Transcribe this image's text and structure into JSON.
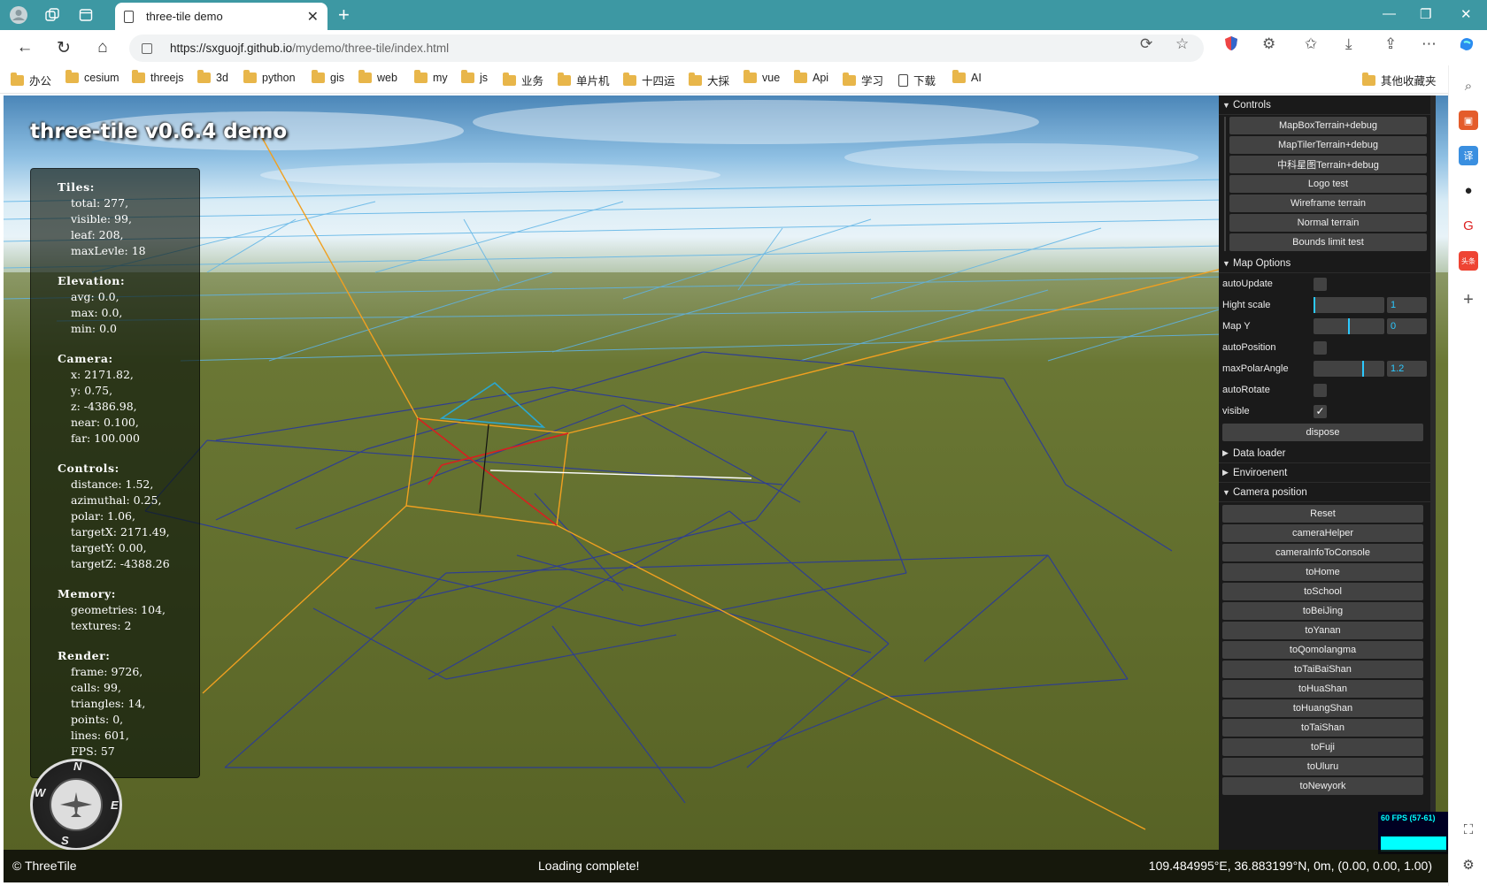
{
  "browser": {
    "tab_title": "three-tile demo",
    "url_host": "https://sxguojf.github.io",
    "url_path": "/mydemo/three-tile/index.html"
  },
  "bookmarks": [
    "办公",
    "cesium",
    "threejs",
    "3d",
    "python",
    "gis",
    "web",
    "my",
    "js",
    "业务",
    "单片机",
    "十四运",
    "大採",
    "vue",
    "Api",
    "学习",
    "下载",
    "AI"
  ],
  "bookmark_other": "其他收藏夹",
  "demo": {
    "title": "three-tile v0.6.4 demo"
  },
  "info": {
    "tiles_head": "Tiles:",
    "tiles": [
      "total: 277,",
      "visible: 99,",
      "leaf: 208,",
      "maxLevle: 18"
    ],
    "elevation_head": "Elevation:",
    "elevation": [
      "avg: 0.0,",
      "max: 0.0,",
      "min: 0.0"
    ],
    "camera_head": "Camera:",
    "camera": [
      "x: 2171.82,",
      "y: 0.75,",
      "z: -4386.98,",
      "near: 0.100,",
      "far: 100.000"
    ],
    "controls_head": "Controls:",
    "controls": [
      "distance: 1.52,",
      "azimuthal: 0.25,",
      "polar: 1.06,",
      "targetX: 2171.49,",
      "targetY: 0.00,",
      "targetZ: -4388.26"
    ],
    "memory_head": "Memory:",
    "memory": [
      "geometries: 104,",
      "textures: 2"
    ],
    "render_head": "Render:",
    "render": [
      "frame: 9726,",
      "calls: 99,",
      "triangles: 14,",
      "points: 0,",
      "lines: 601,",
      "FPS: 57"
    ]
  },
  "compass": {
    "n": "N",
    "e": "E",
    "s": "S",
    "w": "W"
  },
  "statusbar": {
    "copyright": "© ThreeTile",
    "message": "Loading complete!",
    "coords": "109.484995°E, 36.883199°N, 0m, (0.00, 0.00, 1.00)"
  },
  "gui": {
    "controls_title": "Controls",
    "controls_buttons": [
      "MapBoxTerrain+debug",
      "MapTilerTerrain+debug",
      "中科星图Terrain+debug",
      "Logo test",
      "Wireframe terrain",
      "Normal terrain",
      "Bounds limit test"
    ],
    "map_options_title": "Map Options",
    "auto_update": "autoUpdate",
    "hight_scale": "Hight scale",
    "hight_scale_value": "1",
    "hight_scale_fraction": 0.0,
    "map_y": "Map Y",
    "map_y_value": "0",
    "map_y_fraction": 0.5,
    "auto_position": "autoPosition",
    "max_polar_angle": "maxPolarAngle",
    "max_polar_angle_value": "1.2",
    "max_polar_angle_fraction": 0.7,
    "auto_rotate": "autoRotate",
    "visible": "visible",
    "visible_checked": "✓",
    "dispose": "dispose",
    "data_loader_title": "Data loader",
    "environment_title": "Enviroenent",
    "camera_position_title": "Camera position",
    "camera_buttons": [
      "Reset",
      "cameraHelper",
      "cameraInfoToConsole",
      "toHome",
      "toSchool",
      "toBeiJing",
      "toYanan",
      "toQomolangma",
      "toTaiBaiShan",
      "toHuaShan",
      "toHuangShan",
      "toTaiShan",
      "toFuji",
      "toUluru",
      "toNewyork"
    ]
  },
  "fps": {
    "label": "60 FPS (57-61)"
  },
  "colors": {
    "tabbar": "#3d98a3",
    "gui_bg": "#1a1a1a",
    "slider_accent": "#2cc9ff",
    "fps": "#00ffff"
  }
}
